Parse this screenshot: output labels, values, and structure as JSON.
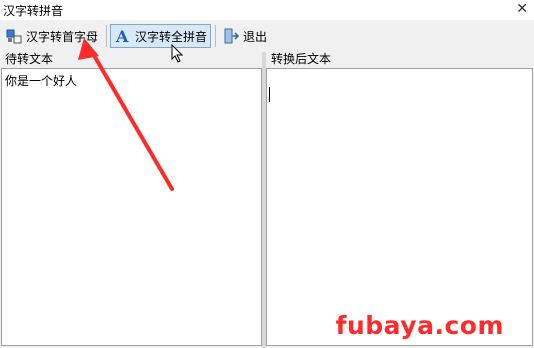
{
  "window": {
    "title": "汉字转拼音",
    "close_glyph": "✕"
  },
  "toolbar": {
    "btn_initials": {
      "label": "汉字转首字母",
      "icon": "initials-icon"
    },
    "btn_full": {
      "label": "汉字转全拼音",
      "icon": "letter-a-icon"
    },
    "btn_exit": {
      "label": "退出",
      "icon": "exit-door-icon"
    }
  },
  "left_panel": {
    "title": "待转文本",
    "content": "你是一个好人"
  },
  "right_panel": {
    "title": "转换后文本",
    "content": ""
  },
  "watermark": "fubaya.com",
  "colors": {
    "accent_arrow": "#ff2a2a",
    "active_button_bg": "#d9e8f7",
    "active_button_border": "#7aa7d8"
  }
}
